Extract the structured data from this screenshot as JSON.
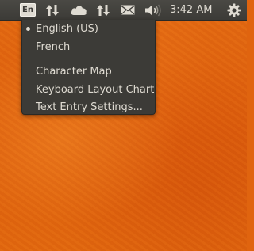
{
  "panel": {
    "keyboard_indicator": "En",
    "clock": "3:42 AM",
    "icons": [
      "network-transfer-icon",
      "cloud-icon",
      "network-transfer-icon",
      "mail-icon",
      "volume-icon",
      "gear-icon"
    ]
  },
  "menu": {
    "items": [
      {
        "label": "English (US)",
        "selected": true
      },
      {
        "label": "French",
        "selected": false
      }
    ],
    "actions": [
      {
        "label": "Character Map"
      },
      {
        "label": "Keyboard Layout Chart"
      },
      {
        "label": "Text Entry Settings..."
      }
    ]
  },
  "colors": {
    "panel": "#3c3b37",
    "text": "#dfdbd2",
    "wallpaper": "#e0640f"
  }
}
